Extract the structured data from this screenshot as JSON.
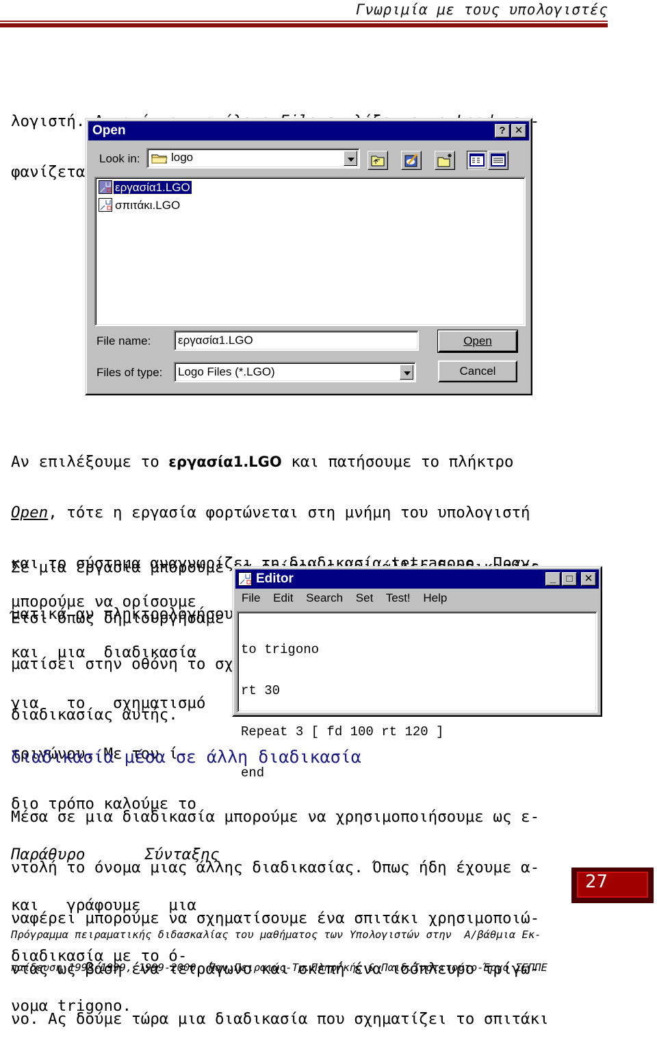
{
  "header": {
    "running_title": "Γνωριμία με τους υπολογιστές",
    "rule_color": "#8a0f0f"
  },
  "intro": {
    "line1_a": "λογιστή. Αν από τον κατάλογο ",
    "line1_file": "File",
    "line1_b": " επιλέξουμε το ",
    "line1_load": "Load…",
    "line1_c": " εμ-",
    "line2": "φανίζεται ένα πλαίσιο παρόμοιο με το ακόλουθο:"
  },
  "open_dialog": {
    "title": "Open",
    "help_button": "?",
    "close_button": "✕",
    "look_in_label": "Look in:",
    "look_in_value": "logo",
    "files": [
      {
        "name": "εργασία1.LGO",
        "selected": true
      },
      {
        "name": "σπιτάκι.LGO",
        "selected": false
      }
    ],
    "file_name_label": "File name:",
    "file_name_value": "εργασία1.LGO",
    "files_of_type_label": "Files of type:",
    "files_of_type_value": "Logo Files (*.LGO)",
    "open_button": "Open",
    "cancel_button": "Cancel",
    "toolbar_icons": [
      "up-one-level-icon",
      "favorites-icon",
      "new-folder-icon",
      "list-view-icon",
      "details-view-icon"
    ]
  },
  "para2": {
    "line1_a": "Αν επιλέξουμε το ",
    "line1_bold": "εργασία1.LGO",
    "line1_b": " και πατήσουμε το πλήκτρο",
    "line2_open": "Open",
    "line2_b": ", τότε η εργασία φορτώνεται στη μνήμη του υπολογιστή",
    "line3": "και το σύστημα αναγνωρίζει τη διαδικασία tetragono. Πραγ-",
    "line4": "ματικά αν πληκτρολογήσουμε το όνομα αυτό η χελώνα θα σχη-",
    "line5": "ματίσει στην οθόνη το σχήμα που δημιουργούν οι εντολές της",
    "line6": "διαδικασίας αυτής."
  },
  "para3": {
    "line1": "Σε μία εργασία μπορούμε να ορίσουμε και άλλες διαδικασίες.",
    "line2": "Έτσι όπως δημιουργήσαμε τη διαδικασία για το τετράγωνο,",
    "side_lines": [
      "μπορούμε να ορίσουμε",
      "και  μια  διαδικασία",
      "για   το   σχηματισμό",
      "τριγώνου. Με τον ί-",
      "διο τρόπο καλούμε το",
      "",
      "και   γράφουμε   μια",
      "διαδικασία με το ό-",
      "νομα trigono."
    ],
    "italic_line_a": "Παράθυρο",
    "italic_line_b": "Σύνταξης"
  },
  "editor": {
    "title": "Editor",
    "minimize": "_",
    "maximize": "□",
    "close": "✕",
    "menu": [
      "File",
      "Edit",
      "Search",
      "Set",
      "Test!",
      "Help"
    ],
    "code_lines": [
      "to trigono",
      "rt 30",
      "Repeat 3 [ fd 100 rt 120 ]",
      "end"
    ]
  },
  "section": {
    "title": "διαδικασία μέσα σε άλλη διαδικασία",
    "lines": [
      "Μέσα σε μια διαδικασία μπορούμε να χρησιμοποιήσουμε ως ε-",
      "ντολή το όνομα μιας άλλης διαδικασίας. Όπως ήδη έχουμε α-",
      "ναφέρει μπορούμε να σχηματίσουμε ένα σπιτάκι χρησιμοποιώ-",
      "ντας ως βάση ένα τετράγωνο και σκεπή ένα ισόπλευρο τρίγω-",
      "νο. Ας δούμε τώρα μια διαδικασία που σχηματίζει το σπιτάκι"
    ]
  },
  "page_number": "27",
  "footer": {
    "line1": "Πρόγραμμα πειραματικής διδασκαλίας του μαθήματος των Υπολογιστών στην  Α/βάθμια Εκ-",
    "line2": "παίδευση 1998-1999, 1999-2000. Παν.Πειραιώς-Τμ.Πληρ/κής & Παιδ.Ινστιτούτο-Έργο ΣΕΠΠΕ"
  }
}
